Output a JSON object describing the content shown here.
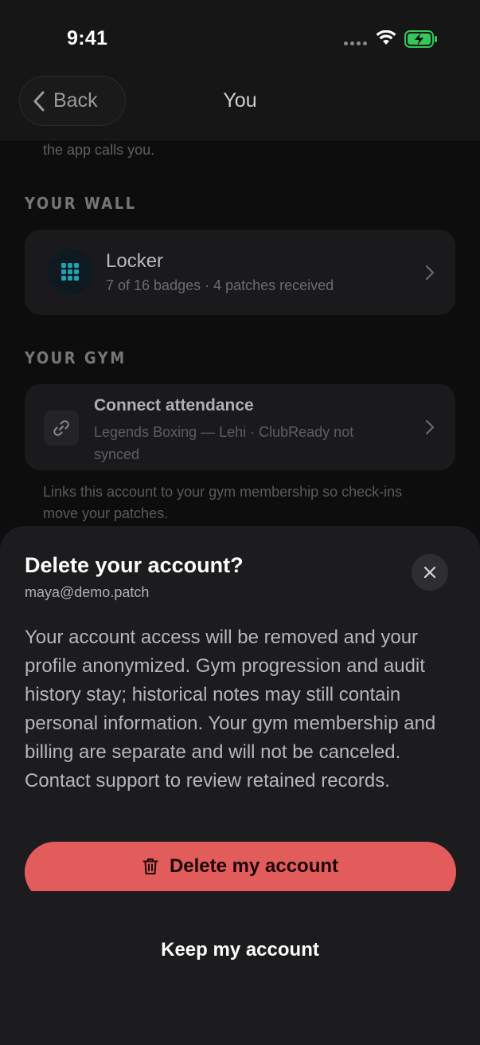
{
  "status_bar": {
    "time": "9:41"
  },
  "nav": {
    "back_label": "Back",
    "title": "You"
  },
  "background": {
    "truncated_note": "the app calls you.",
    "wall_heading": "YOUR WALL",
    "locker": {
      "title": "Locker",
      "subtitle": "7 of 16 badges · 4 patches received",
      "icon": "grid-icon"
    },
    "gym_heading": "YOUR GYM",
    "connect": {
      "title": "Connect attendance",
      "subtitle": "Legends Boxing — Lehi · ClubReady not synced",
      "icon": "link-icon"
    },
    "help_text": "Links this account to your gym membership so check-ins move your patches."
  },
  "sheet": {
    "title": "Delete your account?",
    "email": "maya@demo.patch",
    "body": "Your account access will be removed and your profile anonymized. Gym progression and audit history stay; historical notes may still contain personal information. Your gym membership and billing are separate and will not be canceled. Contact support to review retained records.",
    "delete_label": "Delete my account",
    "keep_label": "Keep my account"
  },
  "colors": {
    "accent_teal": "#1fa0b5",
    "danger": "#e35c5c",
    "battery_green": "#35c759"
  }
}
